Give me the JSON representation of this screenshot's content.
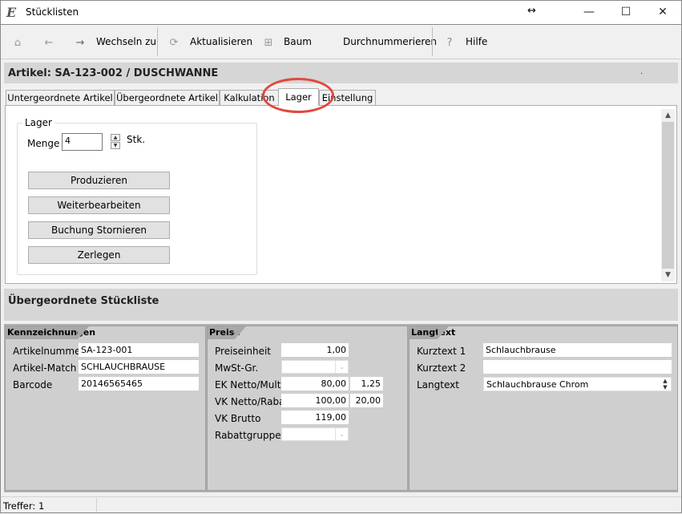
{
  "window": {
    "logo": "E",
    "title": "Stücklisten",
    "resize_icon": "↔",
    "minimize_icon": "—",
    "maximize_icon": "☐",
    "close_icon": "✕"
  },
  "toolbar": {
    "home_icon": "⌂",
    "back_icon": "←",
    "forward_icon": "→",
    "wechseln_label": "Wechseln zu",
    "aktualisieren_label": "Aktualisieren",
    "baum_label": "Baum",
    "durchnummerieren_label": "Durchnummerieren",
    "hilfe_label": "Hilfe",
    "refresh_icon": "⟳",
    "tree_icon": "⊞",
    "help_icon": "?"
  },
  "article": {
    "title": "Artikel: SA-123-002 / DUSCHWANNE",
    "dot": "."
  },
  "tabs": [
    {
      "label": "Untergeordnete Artikel"
    },
    {
      "label": "Übergeordnete Artikel"
    },
    {
      "label": "Kalkulation"
    },
    {
      "label": "Lager"
    },
    {
      "label": "Einstellung"
    }
  ],
  "lager": {
    "legend": "Lager",
    "menge_label": "Menge",
    "menge_value": "4",
    "unit": "Stk.",
    "spin_up": "▲",
    "spin_down": "▼",
    "buttons": {
      "produzieren": "Produzieren",
      "weiterbearbeiten": "Weiterbearbeiten",
      "stornieren": "Buchung Stornieren",
      "zerlegen": "Zerlegen"
    }
  },
  "scroll": {
    "up": "▲",
    "down": "▼"
  },
  "parent": {
    "title": "Übergeordnete Stückliste"
  },
  "kennzeichnungen": {
    "tab": "Kennzeichnungen",
    "artikelnummer_label": "Artikelnummer",
    "artikelnummer_value": "SA-123-001",
    "match_label": "Artikel-Match",
    "match_value": "SCHLAUCHBRAUSE",
    "barcode_label": "Barcode",
    "barcode_value": "20146565465"
  },
  "preise": {
    "tab": "Preise",
    "preiseinheit_label": "Preiseinheit",
    "preiseinheit_value": "1,00",
    "mwst_label": "MwSt-Gr.",
    "ek_label": "EK Netto/Multi",
    "ek_value": "80,00",
    "ek_multi": "1,25",
    "vk_netto_label": "VK Netto/Raba.",
    "vk_netto_value": "100,00",
    "vk_rabatt": "20,00",
    "vk_brutto_label": "VK Brutto",
    "vk_brutto_value": "119,00",
    "rabattgruppe_label": "Rabattgruppe",
    "dropdown_arrow": "⌄"
  },
  "langtext": {
    "tab": "Langtext",
    "kurztext1_label": "Kurztext 1",
    "kurztext1_value": "Schlauchbrause",
    "kurztext2_label": "Kurztext 2",
    "kurztext2_value": "",
    "langtext_label": "Langtext",
    "langtext_value": "Schlauchbrause Chrom"
  },
  "status": {
    "text": "Treffer: 1"
  }
}
